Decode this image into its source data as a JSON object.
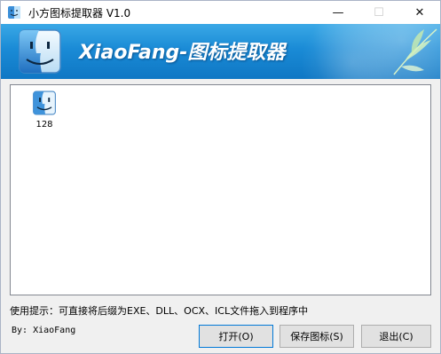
{
  "window": {
    "title": "小方图标提取器 V1.0",
    "controls": {
      "minimize": "—",
      "maximize": "☐",
      "close": "✕"
    }
  },
  "banner": {
    "title": "XiaoFang-图标提取器",
    "logo_icon": "finder-face-icon",
    "decoration_icon": "bamboo-leaf-icon"
  },
  "icon_area": {
    "items": [
      {
        "icon": "finder-face-icon",
        "caption": "128"
      }
    ]
  },
  "hint": "使用提示：可直接将后缀为EXE、DLL、OCX、ICL文件拖入到程序中",
  "byline": "By: XiaoFang",
  "buttons": {
    "open": "打开(O)",
    "save": "保存图标(S)",
    "exit": "退出(C)"
  },
  "colors": {
    "banner_top": "#3aa8e6",
    "banner_bottom": "#0f77c4",
    "button_focus_border": "#0078d7"
  }
}
